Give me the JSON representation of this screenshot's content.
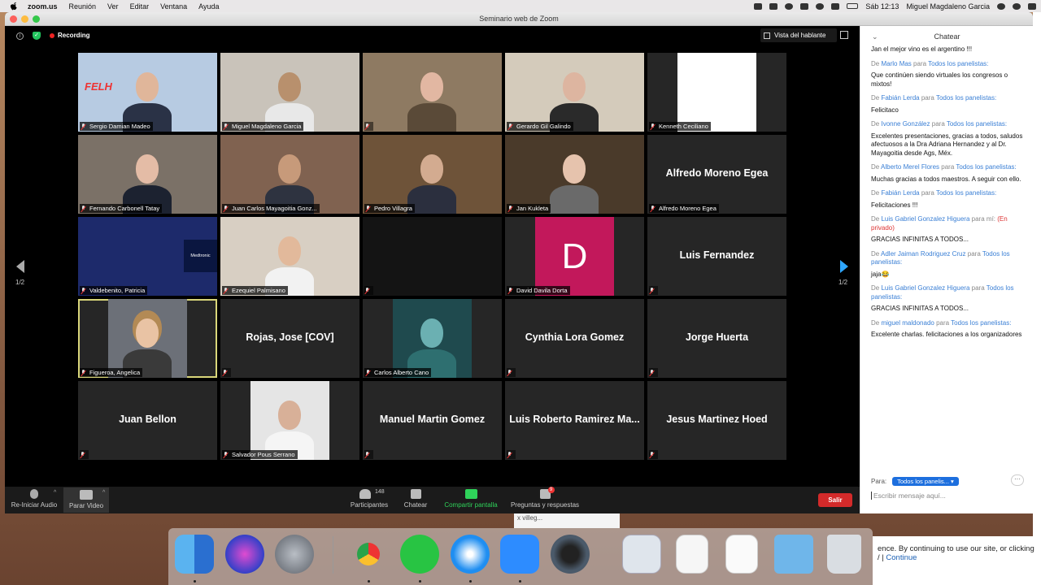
{
  "menubar": {
    "app": "zoom.us",
    "menus": [
      "Reunión",
      "Ver",
      "Editar",
      "Ventana",
      "Ayuda"
    ],
    "clock": "Sáb 12:13",
    "user": "Miguel Magdaleno Garcia"
  },
  "window": {
    "title": "Seminario web de Zoom",
    "recording": "Recording",
    "view_label": "Vista del hablante",
    "page_indicator": "1/2"
  },
  "participants": [
    {
      "label": "Sergio Damian Madeo"
    },
    {
      "label": "Miguel Magdaleno Garcia"
    },
    {
      "label": ""
    },
    {
      "label": "Gerardo Gil Galindo"
    },
    {
      "label": "Kenneth Ceciliano"
    },
    {
      "label": "Fernando Carbonell Tatay"
    },
    {
      "label": "Juan Carlos Mayagoitia Gonz..."
    },
    {
      "label": "Pedro Villagra"
    },
    {
      "label": "Jan Kukleta"
    },
    {
      "label": "Alfredo Moreno Egea",
      "name": "Alfredo Moreno Egea"
    },
    {
      "label": "Valdebenito, Patricia",
      "logo": "Medtronic"
    },
    {
      "label": "Ezequiel Palmisano"
    },
    {
      "label": ""
    },
    {
      "label": "David Davila Dorta",
      "initial": "D"
    },
    {
      "label": "",
      "name": "Luis Fernandez"
    },
    {
      "label": "Figueroa, Angelica"
    },
    {
      "label": "",
      "name": "Rojas, Jose [COV]"
    },
    {
      "label": "Carlos Alberto Cano"
    },
    {
      "label": "",
      "name": "Cynthia Lora Gomez"
    },
    {
      "label": "",
      "name": "Jorge Huerta"
    },
    {
      "label": "",
      "name": "Juan Bellon"
    },
    {
      "label": "Salvador Pous Serrano"
    },
    {
      "label": "",
      "name": "Manuel Martin Gomez"
    },
    {
      "label": "",
      "name": "Luis Roberto Ramirez Ma..."
    },
    {
      "label": "",
      "name": "Jesus Martinez Hoed"
    }
  ],
  "toolbar": {
    "audio": "Re-Iniciar Audio",
    "video": "Parar Video",
    "participants": "Participantes",
    "participants_count": "148",
    "chat": "Chatear",
    "share": "Compartir pantalla",
    "qa": "Preguntas y respuestas",
    "qa_badge": "9",
    "leave": "Salir"
  },
  "chat": {
    "title": "Chatear",
    "messages": [
      {
        "from": "",
        "to": "",
        "text": "Jan el mejor vino es el argentino !!!"
      },
      {
        "from": "Marlo Mas",
        "to": "Todos los panelistas:",
        "text": "Que continúen siendo virtuales los congresos o mixtos!"
      },
      {
        "from": "Fabián Lerda",
        "to": "Todos los panelistas:",
        "text": "Felicitaco"
      },
      {
        "from": "Ivonne González",
        "to": "Todos los panelistas:",
        "text": "Excelentes presentaciones, gracias a todos, saludos afectuosos a la Dra Adriana Hernandez y al Dr. Mayagoitia desde Ags, Méx."
      },
      {
        "from": "Alberto Merel Flores",
        "to": "Todos los panelistas:",
        "text": "Muchas gracias a todos maestros. A seguir con ello."
      },
      {
        "from": "Fabián Lerda",
        "to": "Todos los panelistas:",
        "text": "Felicitaciones !!!"
      },
      {
        "from": "Luis Gabriel Gonzalez Higuera",
        "to": "mí:",
        "private": "(En privado)",
        "text": "GRACIAS INFINITAS A TODOS..."
      },
      {
        "from": "Adler Jaiman Rodriguez Cruz",
        "to": "Todos los panelistas:",
        "text": "jaja😂"
      },
      {
        "from": "Luis Gabriel Gonzalez Higuera",
        "to": "Todos los panelistas:",
        "text": "GRACIAS INFINITAS A TODOS..."
      },
      {
        "from": "miguel maldonado",
        "to": "Todos los panelistas:",
        "text": "Excelente charlas. felicitaciones a los organizadores"
      }
    ],
    "word_de": "De",
    "word_para": "para",
    "to_label": "Para:",
    "to_value": "Todos los panelis...",
    "placeholder": "Escribir mensaje aquí..."
  },
  "background": {
    "cookie_text": "ence. By continuing to use our site, or clicking",
    "cookie_link": "Continue",
    "tab_text": "x villeg..."
  },
  "colors": {
    "accent": "#2ea6ff",
    "leave": "#d32a2a",
    "share": "#2fd25a",
    "highlight": "#d9d67a"
  }
}
